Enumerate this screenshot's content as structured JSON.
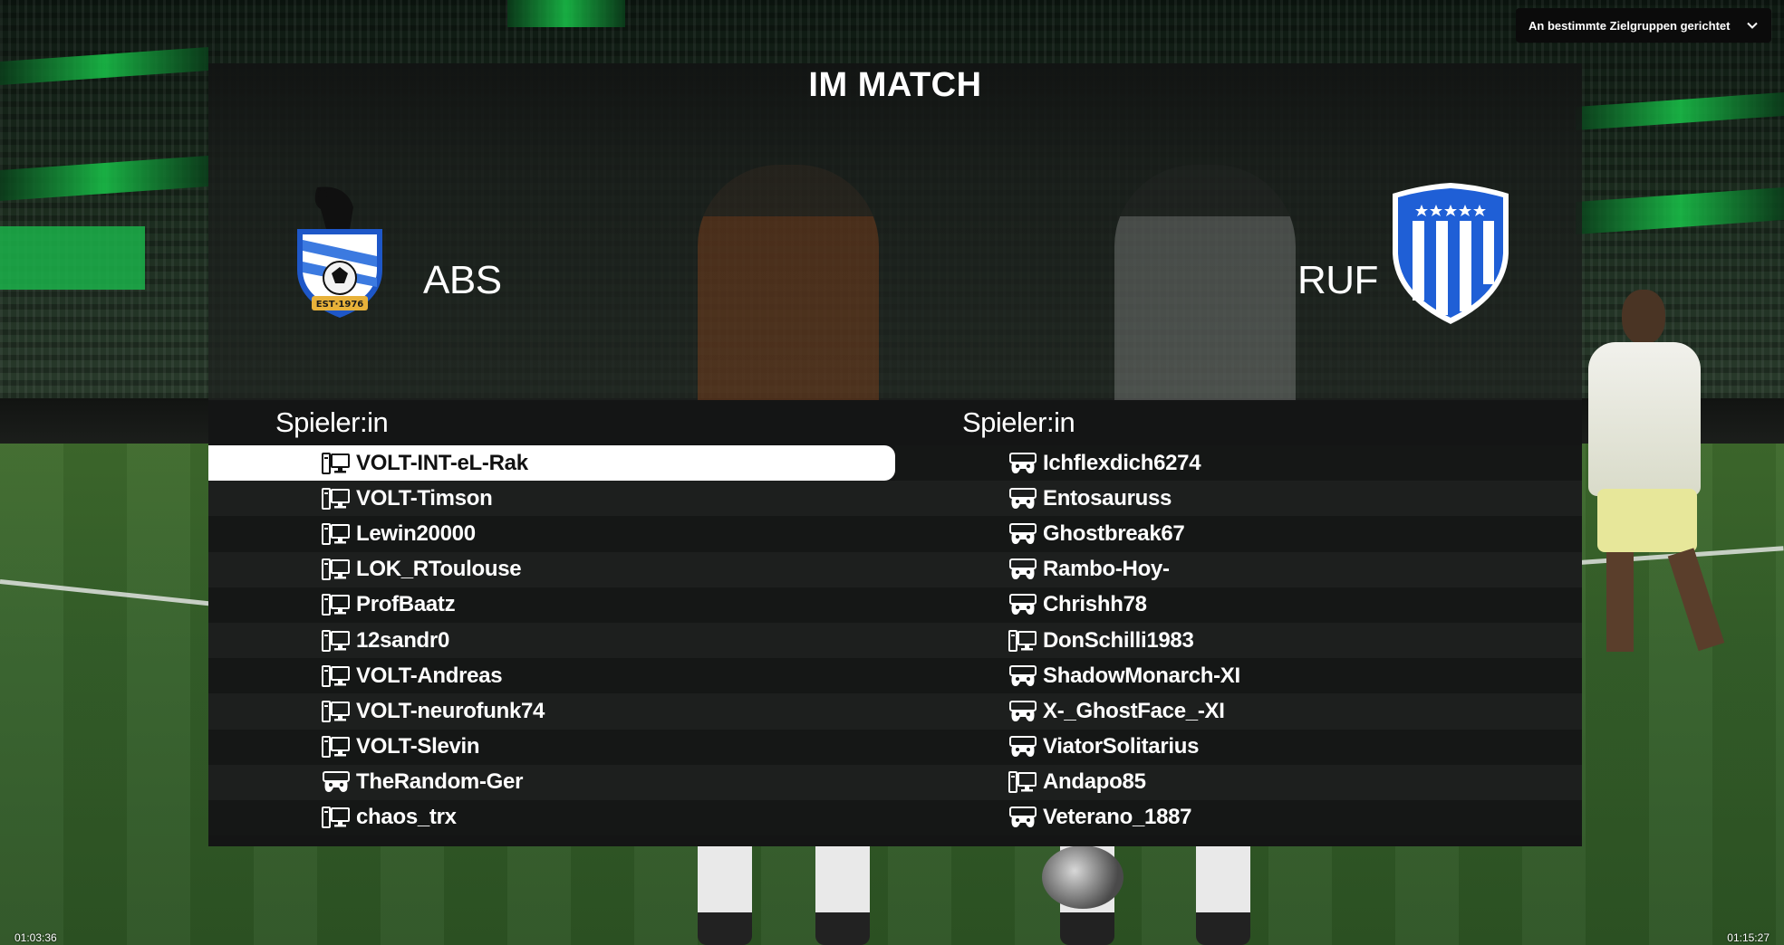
{
  "audience_dropdown": {
    "label": "An bestimmte Zielgruppen gerichtet"
  },
  "match": {
    "title": "IM MATCH",
    "home": {
      "abbr": "ABS",
      "crest_text": "EST·1976"
    },
    "away": {
      "abbr": "RUF"
    }
  },
  "roster": {
    "home": {
      "header": "Spieler:in",
      "players": [
        {
          "name": "VOLT-INT-eL-Rak",
          "platform": "pc-icon",
          "selected": true
        },
        {
          "name": "VOLT-Timson",
          "platform": "pc-icon"
        },
        {
          "name": "Lewin20000",
          "platform": "pc-icon"
        },
        {
          "name": "LOK_RToulouse",
          "platform": "pc-icon"
        },
        {
          "name": "ProfBaatz",
          "platform": "pc-icon"
        },
        {
          "name": "12sandr0",
          "platform": "pc-icon"
        },
        {
          "name": "VOLT-Andreas",
          "platform": "pc-icon"
        },
        {
          "name": "VOLT-neurofunk74",
          "platform": "pc-icon"
        },
        {
          "name": "VOLT-Slevin",
          "platform": "pc-icon"
        },
        {
          "name": "TheRandom-Ger",
          "platform": "console-icon"
        },
        {
          "name": "chaos_trx",
          "platform": "pc-icon"
        }
      ]
    },
    "away": {
      "header": "Spieler:in",
      "players": [
        {
          "name": "Ichflexdich6274",
          "platform": "console-icon"
        },
        {
          "name": "Entosauruss",
          "platform": "console-icon"
        },
        {
          "name": "Ghostbreak67",
          "platform": "console-icon"
        },
        {
          "name": "Rambo-Hoy-",
          "platform": "console-icon"
        },
        {
          "name": "Chrishh78",
          "platform": "console-icon"
        },
        {
          "name": "DonSchilli1983",
          "platform": "pc-icon"
        },
        {
          "name": "ShadowMonarch-XI",
          "platform": "console-icon"
        },
        {
          "name": "X-_GhostFace_-XI",
          "platform": "console-icon"
        },
        {
          "name": "ViatorSolitarius",
          "platform": "console-icon"
        },
        {
          "name": "Andapo85",
          "platform": "pc-icon"
        },
        {
          "name": "Veterano_1887",
          "platform": "console-icon"
        }
      ]
    }
  },
  "video": {
    "elapsed": "01:03:36",
    "remaining": "01:15:27"
  },
  "colors": {
    "selected_row": "#ffffff",
    "accent_green": "#19c64a",
    "away_crest_blue": "#1f5fd6"
  }
}
